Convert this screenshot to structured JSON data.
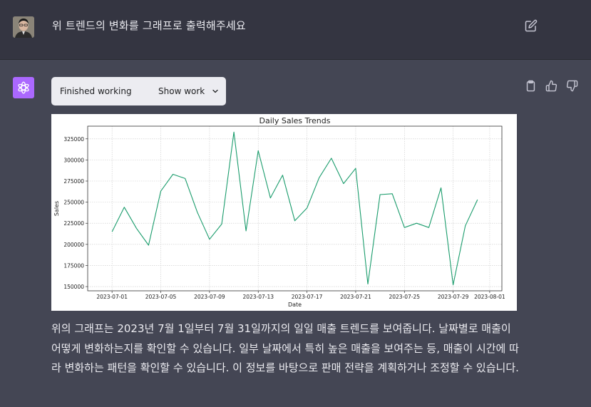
{
  "conversation": {
    "user_message": "위 트렌드의 변화를 그래프로 출력해주세요",
    "tool_status": "Finished working",
    "show_work_label": "Show work",
    "answer_text": "위의 그래프는 2023년 7월 1일부터 7월 31일까지의 일일 매출 트렌드를 보여줍니다. 날짜별로 매출이 어떻게 변화하는지를 확인할 수 있습니다. 일부 날짜에서 특히 높은 매출을 보여주는 등, 매출이 시간에 따라 변화하는 패턴을 확인할 수 있습니다. 이 정보를 바탕으로 판매 전략을 계획하거나 조정할 수 있습니다."
  },
  "icons": {
    "edit": "edit-icon",
    "copy": "clipboard-icon",
    "thumbs_up": "thumbs-up-icon",
    "thumbs_down": "thumbs-down-icon",
    "chevron": "chevron-down-icon",
    "assistant_logo": "openai-logo-icon"
  },
  "colors": {
    "line": "#1a9c6c",
    "assistant_logo_bg": "#ab68ff"
  },
  "chart_data": {
    "type": "line",
    "title": "Daily Sales Trends",
    "xlabel": "Date",
    "ylabel": "Sales",
    "x_tick_labels": [
      "2023-07-01",
      "2023-07-05",
      "2023-07-09",
      "2023-07-13",
      "2023-07-17",
      "2023-07-21",
      "2023-07-25",
      "2023-07-29",
      "2023-08-01"
    ],
    "y_tick_labels": [
      "150000",
      "175000",
      "200000",
      "225000",
      "250000",
      "275000",
      "300000",
      "325000"
    ],
    "ylim": [
      145000,
      340000
    ],
    "grid": true,
    "series": [
      {
        "x": [
          "2023-07-01",
          "2023-07-02",
          "2023-07-03",
          "2023-07-04",
          "2023-07-05",
          "2023-07-06",
          "2023-07-07",
          "2023-07-08",
          "2023-07-09",
          "2023-07-10",
          "2023-07-11",
          "2023-07-12",
          "2023-07-13",
          "2023-07-14",
          "2023-07-15",
          "2023-07-16",
          "2023-07-17",
          "2023-07-18",
          "2023-07-19",
          "2023-07-20",
          "2023-07-21",
          "2023-07-22",
          "2023-07-23",
          "2023-07-24",
          "2023-07-25",
          "2023-07-26",
          "2023-07-27",
          "2023-07-28",
          "2023-07-29",
          "2023-07-30",
          "2023-07-31"
        ],
        "values": [
          215000,
          244000,
          219000,
          199000,
          263000,
          283000,
          278000,
          238000,
          206000,
          224000,
          333000,
          216000,
          311000,
          255000,
          282000,
          228000,
          243000,
          279000,
          302000,
          272000,
          290000,
          153000,
          259000,
          260000,
          220000,
          225000,
          220000,
          267000,
          152000,
          222000,
          253000
        ]
      }
    ]
  }
}
